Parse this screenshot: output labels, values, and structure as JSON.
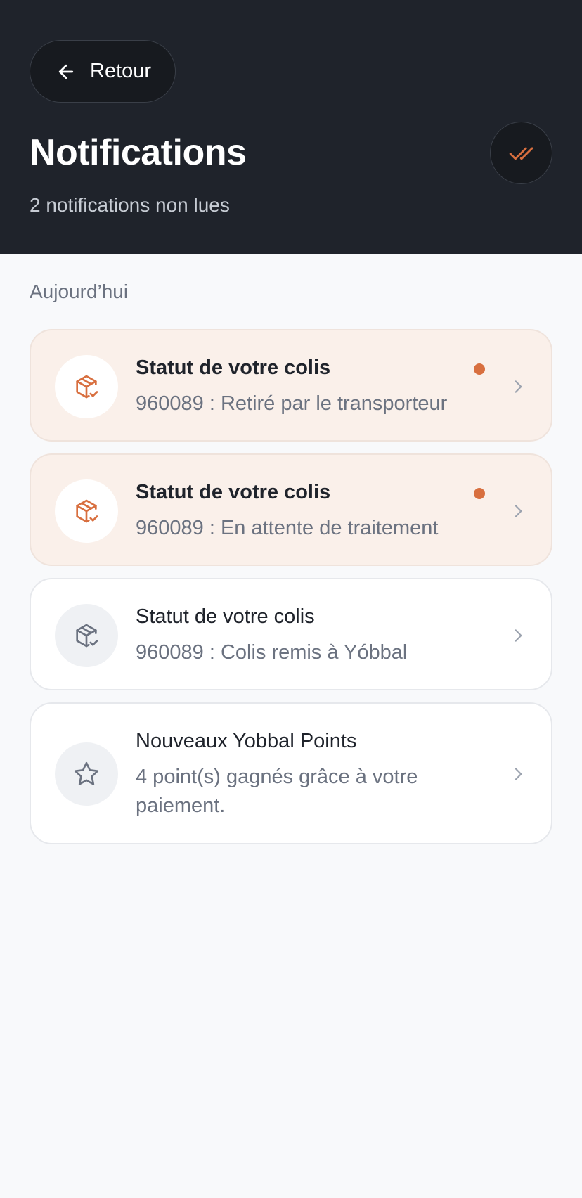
{
  "header": {
    "back_label": "Retour",
    "title": "Notifications",
    "subtitle": "2 notifications non lues"
  },
  "section": {
    "label": "Aujourd’hui"
  },
  "notifications": [
    {
      "title": "Statut de votre colis",
      "body": "960089 : Retiré par le transporteur",
      "unread": true,
      "icon": "package-check-icon"
    },
    {
      "title": "Statut de votre colis",
      "body": "960089 : En attente de traitement",
      "unread": true,
      "icon": "package-check-icon"
    },
    {
      "title": "Statut de votre colis",
      "body": "960089 : Colis remis à Yóbbal",
      "unread": false,
      "icon": "package-check-icon"
    },
    {
      "title": "Nouveaux Yobbal Points",
      "body": "4 point(s) gagnés grâce à votre paiement.",
      "unread": false,
      "icon": "star-icon"
    }
  ],
  "colors": {
    "header_bg": "#1f232b",
    "accent": "#d86f3f",
    "unread_card_bg": "#faf0ea",
    "page_bg": "#f8f9fb"
  }
}
